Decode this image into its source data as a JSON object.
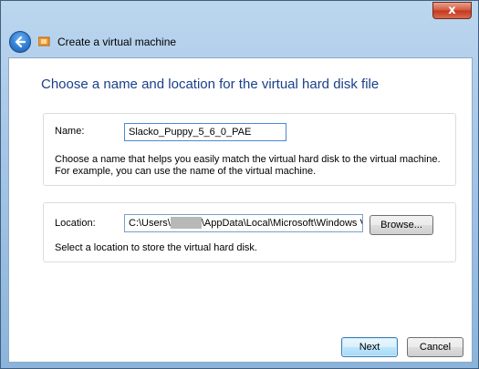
{
  "window": {
    "title": "Create a virtual machine",
    "close_glyph": "x"
  },
  "page": {
    "heading": "Choose a name and location for the virtual hard disk file"
  },
  "name_section": {
    "label": "Name:",
    "value": "Slacko_Puppy_5_6_0_PAE",
    "description_line1": "Choose a name that helps you easily match the virtual hard disk to the virtual machine.",
    "description_line2": "For example, you can use the name of the virtual machine."
  },
  "location_section": {
    "label": "Location:",
    "value_prefix": "C:\\Users\\",
    "value_suffix": "\\AppData\\Local\\Microsoft\\Windows V",
    "browse_label": "Browse...",
    "description": "Select a location to store the virtual hard disk."
  },
  "footer": {
    "next_label": "Next",
    "cancel_label": "Cancel"
  },
  "icons": {
    "back": "back-arrow-icon",
    "app": "virtual-machine-icon",
    "close": "close-icon"
  },
  "colors": {
    "heading": "#1a3f8a",
    "close_button": "#c2371c",
    "back_button": "#2f7fd6"
  }
}
